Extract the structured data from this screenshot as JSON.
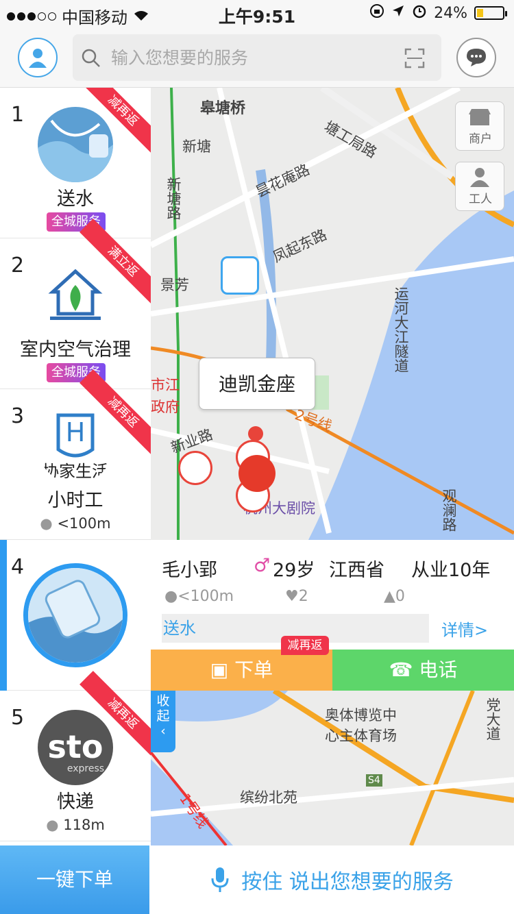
{
  "status_bar": {
    "carrier": "中国移动",
    "time": "上午9:51",
    "battery_pct": "24%",
    "battery_level": 0.24
  },
  "header": {
    "search_placeholder": "输入您想要的服务",
    "icons": [
      "profile-icon",
      "search-icon",
      "scan-icon",
      "chat-icon"
    ]
  },
  "services": [
    {
      "num": "1",
      "name": "送水",
      "tag": "全城服务",
      "ribbon": "减再返"
    },
    {
      "num": "2",
      "name": "室内空气治理",
      "tag": "全城服务",
      "ribbon": "满立返"
    },
    {
      "num": "3",
      "name": "小时工",
      "distance": "<100m",
      "ribbon": "减再返"
    },
    {
      "num": "4"
    },
    {
      "num": "5",
      "name": "快递",
      "distance": "118m",
      "ribbon": "减再返"
    }
  ],
  "thumb_text": {
    "item3_mark": "H",
    "item3_caption": "协家生活",
    "item5_logo": "sto",
    "item5_sub": "express"
  },
  "map": {
    "labels": [
      "皋塘桥",
      "新塘",
      "塘工局路",
      "新塘路",
      "昙花庵路",
      "凤起东路",
      "景芳",
      "运河大江隧道",
      "市江",
      "政府",
      "新业路",
      "2号线",
      "观澜路",
      "杭州大剧院"
    ],
    "tools": [
      {
        "label": "商户"
      },
      {
        "label": "工人"
      }
    ],
    "popup": "迪凯金座"
  },
  "map2": {
    "labels": [
      "奥体博览中",
      "心主体育场",
      "缤纷北苑",
      "S4",
      "党大道",
      "1号线"
    ]
  },
  "collapse_label": "收起",
  "worker": {
    "name": "毛小郢",
    "gender_symbol": "♂",
    "age": "29岁",
    "province": "江西省",
    "experience": "从业10年",
    "distance": "<100m",
    "likes": "2",
    "thumbs": "0",
    "service": "送水",
    "detail_link": "详情>",
    "order_label": "下单",
    "order_badge": "减再返",
    "call_label": "电话"
  },
  "bottom": {
    "quick_order": "一键下单",
    "voice_prompt": "按住 说出您想要的服务"
  }
}
